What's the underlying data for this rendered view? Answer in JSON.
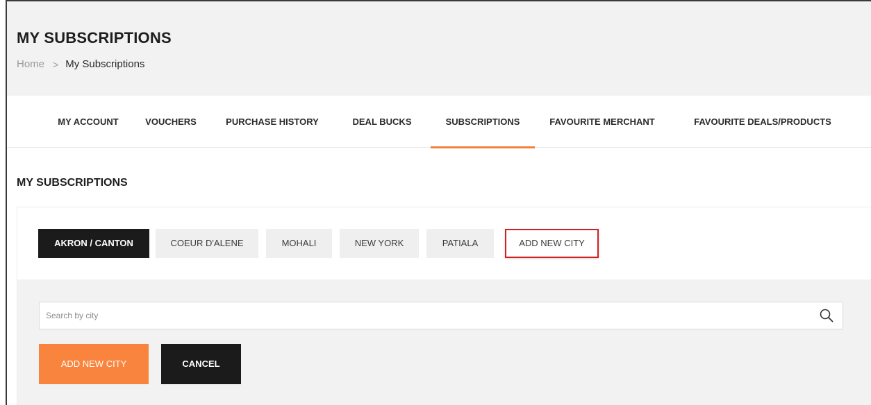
{
  "header": {
    "title": "MY SUBSCRIPTIONS",
    "breadcrumb": {
      "home": "Home",
      "separator": ">",
      "current": "My Subscriptions"
    }
  },
  "tabs": [
    {
      "label": "MY ACCOUNT",
      "active": false
    },
    {
      "label": "VOUCHERS",
      "active": false
    },
    {
      "label": "PURCHASE HISTORY",
      "active": false
    },
    {
      "label": "DEAL BUCKS",
      "active": false
    },
    {
      "label": "SUBSCRIPTIONS",
      "active": true
    },
    {
      "label": "FAVOURITE MERCHANT",
      "active": false
    },
    {
      "label": "FAVOURITE DEALS/PRODUCTS",
      "active": false
    }
  ],
  "section": {
    "title": "MY SUBSCRIPTIONS"
  },
  "cities": [
    {
      "label": "AKRON / CANTON",
      "active": true
    },
    {
      "label": "COEUR D'ALENE",
      "active": false
    },
    {
      "label": "MOHALI",
      "active": false
    },
    {
      "label": "NEW YORK",
      "active": false
    },
    {
      "label": "PATIALA",
      "active": false
    }
  ],
  "add_city_tab": {
    "label": "ADD NEW CITY"
  },
  "search": {
    "placeholder": "Search by city",
    "value": "",
    "icon": "search-icon"
  },
  "actions": {
    "add_label": "ADD NEW CITY",
    "cancel_label": "CANCEL"
  },
  "colors": {
    "accent": "#f47f3d",
    "add_button": "#f9843e",
    "dark": "#1b1b1b",
    "highlight": "#d21f1f"
  }
}
